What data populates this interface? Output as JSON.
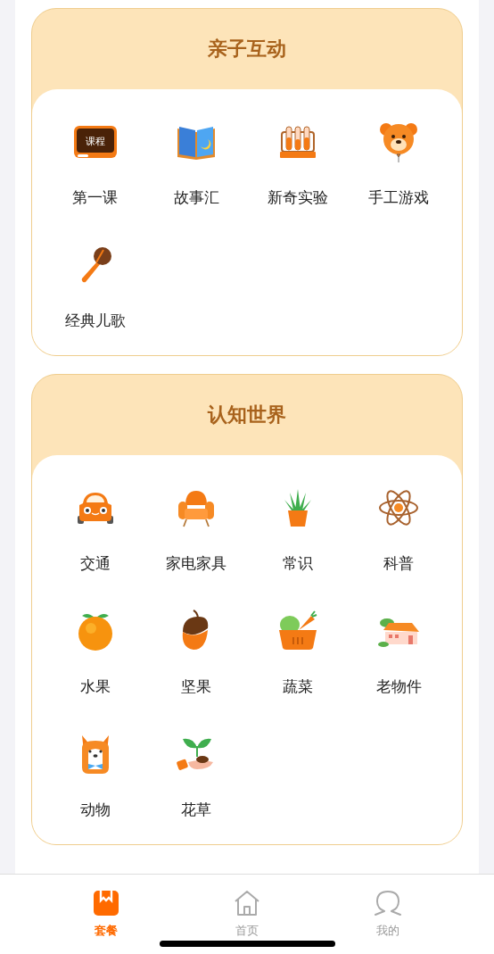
{
  "sections": [
    {
      "title": "亲子互动",
      "items": [
        {
          "label": "第一课",
          "kind": "blackboard",
          "icon_text": "课程"
        },
        {
          "label": "故事汇",
          "kind": "book"
        },
        {
          "label": "新奇实验",
          "kind": "tubes"
        },
        {
          "label": "手工游戏",
          "kind": "bear"
        },
        {
          "label": "经典儿歌",
          "kind": "microphone"
        }
      ]
    },
    {
      "title": "认知世界",
      "items": [
        {
          "label": "交通",
          "kind": "car"
        },
        {
          "label": "家电家具",
          "kind": "armchair"
        },
        {
          "label": "常识",
          "kind": "plant"
        },
        {
          "label": "科普",
          "kind": "atom"
        },
        {
          "label": "水果",
          "kind": "orange"
        },
        {
          "label": "坚果",
          "kind": "acorn"
        },
        {
          "label": "蔬菜",
          "kind": "basket"
        },
        {
          "label": "老物件",
          "kind": "house"
        },
        {
          "label": "动物",
          "kind": "dog"
        },
        {
          "label": "花草",
          "kind": "seedling"
        }
      ]
    }
  ],
  "tabs": [
    {
      "label": "套餐",
      "kind": "bookmark",
      "selected": true
    },
    {
      "label": "首页",
      "kind": "home",
      "selected": false
    },
    {
      "label": "我的",
      "kind": "person",
      "selected": false
    }
  ]
}
